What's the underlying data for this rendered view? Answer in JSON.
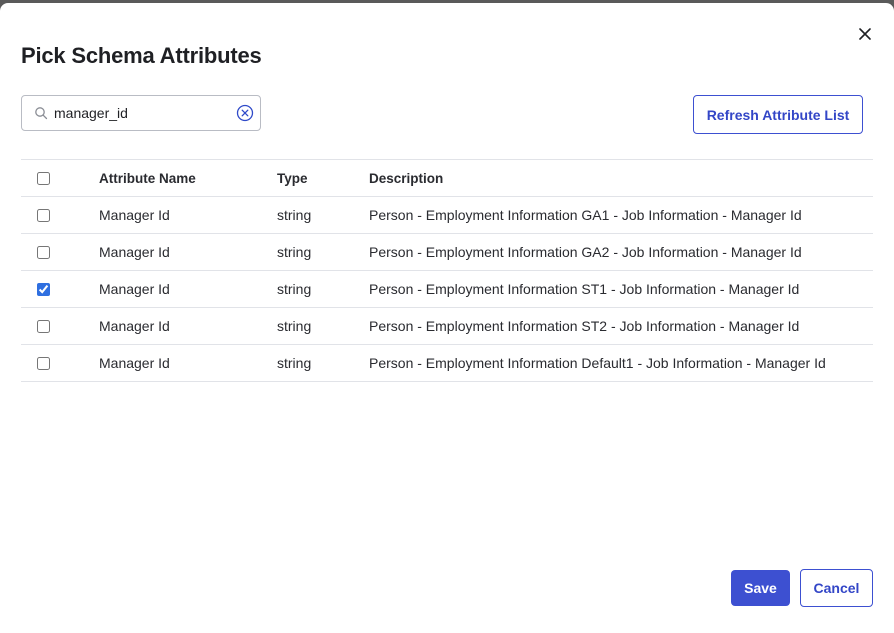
{
  "dialog": {
    "title": "Pick Schema Attributes",
    "close_icon": "close-icon"
  },
  "search": {
    "value": "manager_id",
    "search_icon": "search-icon",
    "clear_icon": "clear-circle-icon"
  },
  "toolbar": {
    "refresh_label": "Refresh Attribute List"
  },
  "table": {
    "headers": {
      "attribute_name": "Attribute Name",
      "type": "Type",
      "description": "Description"
    },
    "select_all_checked": false,
    "rows": [
      {
        "name": "Manager Id",
        "type": "string",
        "description": "Person - Employment Information GA1 - Job Information - Manager Id",
        "checked": false
      },
      {
        "name": "Manager Id",
        "type": "string",
        "description": "Person - Employment Information GA2 - Job Information - Manager Id",
        "checked": false
      },
      {
        "name": "Manager Id",
        "type": "string",
        "description": "Person - Employment Information ST1 - Job Information - Manager Id",
        "checked": true
      },
      {
        "name": "Manager Id",
        "type": "string",
        "description": "Person - Employment Information ST2 - Job Information - Manager Id",
        "checked": false
      },
      {
        "name": "Manager Id",
        "type": "string",
        "description": "Person - Employment Information Default1 - Job Information - Manager Id",
        "checked": false
      }
    ]
  },
  "footer": {
    "save_label": "Save",
    "cancel_label": "Cancel"
  },
  "colors": {
    "primary": "#3d50d1",
    "checkbox_accent": "#2f6fe0"
  }
}
